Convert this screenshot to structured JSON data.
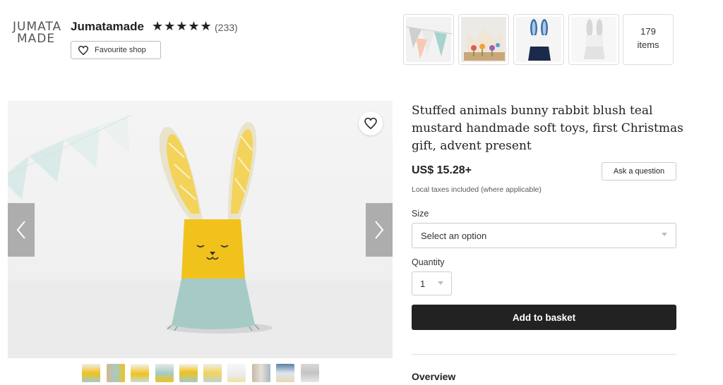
{
  "shop": {
    "logo_line1": "JUMATA",
    "logo_line2": "MADE",
    "name": "Jumatamade",
    "stars": "★★★★★",
    "review_count": "(233)",
    "favourite_label": "Favourite shop",
    "items_count": "179",
    "items_label": "items"
  },
  "product": {
    "title": "Stuffed animals bunny rabbit blush teal mustard handmade soft toys, first Christmas gift, advent present",
    "price": "US$ 15.28+",
    "ask_label": "Ask a question",
    "tax_note": "Local taxes included (where applicable)",
    "size_label": "Size",
    "size_value": "Select an option",
    "quantity_label": "Quantity",
    "quantity_value": "1",
    "add_label": "Add to basket",
    "overview_label": "Overview"
  },
  "colors": {
    "mustard": "#f1c21b",
    "teal": "#a6cbc6",
    "button_dark": "#222222"
  }
}
